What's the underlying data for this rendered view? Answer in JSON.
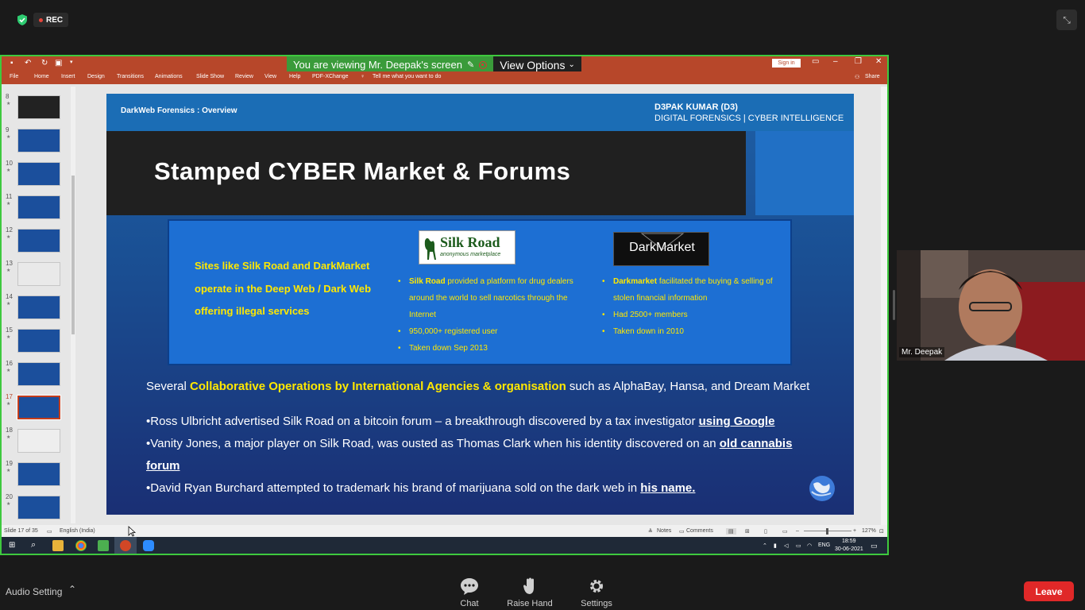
{
  "zoom": {
    "rec_label": "REC",
    "viewing_text": "You are viewing Mr. Deepak's screen",
    "view_options": "View Options",
    "participant_name": "Mr. Deepak",
    "bottom": {
      "audio": "Audio Setting",
      "chat": "Chat",
      "raise_hand": "Raise Hand",
      "settings": "Settings",
      "leave": "Leave"
    },
    "accent_color": "#3ec93e",
    "leave_color": "#e02828"
  },
  "ppt": {
    "tabs": [
      "File",
      "Home",
      "Insert",
      "Design",
      "Transitions",
      "Animations",
      "Slide Show",
      "Review",
      "View",
      "Help",
      "PDF-XChange"
    ],
    "tell_me": "Tell me what you want to do",
    "sign_in": "Sign in",
    "share": "Share",
    "status_slide": "Slide 17 of 35",
    "status_lang": "English (India)",
    "notes": "Notes",
    "comments": "Comments",
    "zoom_pct": "127%",
    "thumb_numbers": [
      "8",
      "9",
      "10",
      "11",
      "12",
      "13",
      "14",
      "15",
      "16",
      "17",
      "18",
      "19",
      "20"
    ],
    "current_slide": "17",
    "ribbon_color": "#b7472a"
  },
  "slide": {
    "crumb": "DarkWeb Forensics : Overview",
    "author_line1": "D3PAK KUMAR (D3)",
    "author_line2": "DIGITAL FORENSICS | CYBER INTELLIGENCE",
    "title": "Stamped CYBER Market & Forums",
    "lead": "Sites like Silk Road and DarkMarket operate in the Deep Web / Dark Web offering illegal services",
    "silk_logo_title": "Silk Road",
    "silk_logo_sub": "anonymous marketplace",
    "dm_logo_title": "DarkMarket",
    "silk_bullets": [
      {
        "strong": "Silk Road",
        "text": " provided a platform for drug dealers around the world to sell narcotics through the Internet"
      },
      {
        "strong": "",
        "text": "950,000+ registered user"
      },
      {
        "strong": "",
        "text": "Taken down Sep 2013"
      }
    ],
    "dm_bullets": [
      {
        "strong": "Darkmarket",
        "text": " facilitated the buying & selling of stolen financial information"
      },
      {
        "strong": "",
        "text": "Had 2500+ members"
      },
      {
        "strong": "",
        "text": "Taken down in 2010"
      }
    ],
    "collab_prefix": "Several ",
    "collab_highlight": "Collaborative Operations by International Agencies & organisation",
    "collab_suffix": " such as AlphaBay, Hansa, and Dream Market",
    "fact1_text": "•Ross Ulbricht advertised Silk Road on a bitcoin forum – a breakthrough discovered by a tax investigator ",
    "fact1_link": "using Google",
    "fact2_text": "•Vanity Jones, a major player on Silk Road, was ousted as Thomas Clark when his identity discovered on an ",
    "fact2_link_a": "old cannabis",
    "fact2_link_b": "forum",
    "fact3_text": "•David Ryan Burchard attempted to trademark his brand of marijuana sold on the dark web in ",
    "fact3_link": "his name."
  },
  "taskbar": {
    "lang": "ENG",
    "time": "18:59",
    "date": "30-06-2021"
  }
}
